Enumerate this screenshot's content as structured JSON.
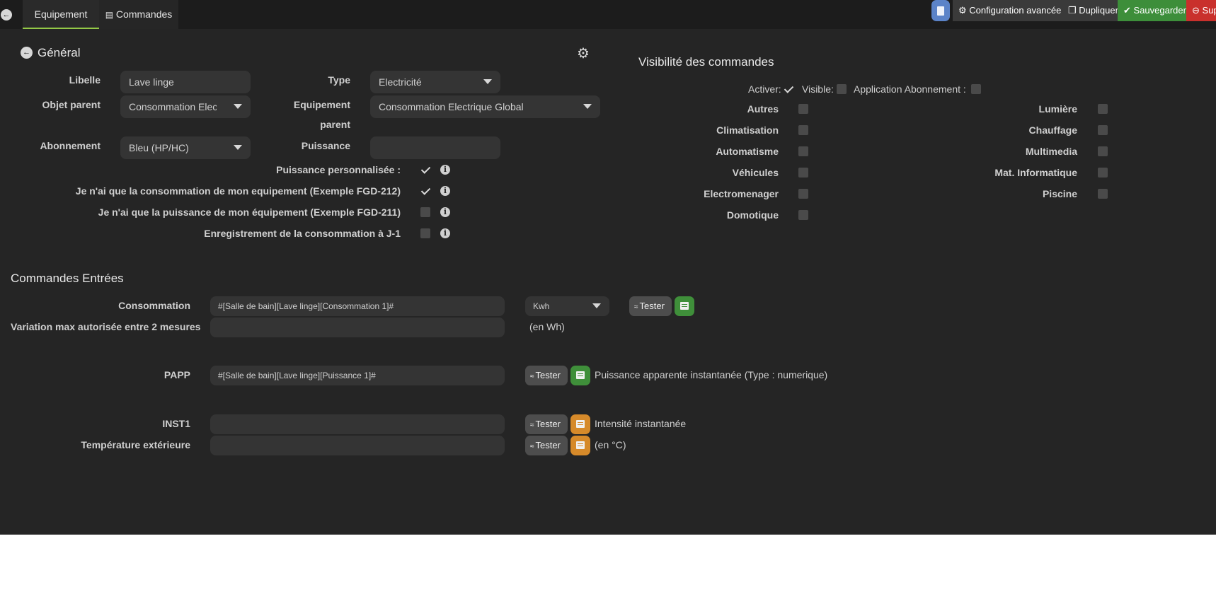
{
  "topbar": {
    "tabs": [
      {
        "label": "Equipement",
        "active": true
      },
      {
        "label": "Commandes",
        "active": false
      }
    ],
    "buttons": {
      "config": "Configuration avancée",
      "duplicate": "Dupliquer",
      "save": "Sauvegarder",
      "delete": "Supprimer"
    },
    "colors": {
      "save": "#3d8e3a",
      "delete": "#c9302c",
      "doc": "#5b83c8"
    }
  },
  "general": {
    "title": "Général",
    "fields": {
      "libelle_label": "Libelle",
      "libelle_value": "Lave linge",
      "type_label": "Type",
      "type_value": "Electricité",
      "objet_parent_label": "Objet parent",
      "objet_parent_value": "Consommation Electrique Global",
      "equipement_parent_label_1": "Equipement",
      "equipement_parent_label_2": "parent",
      "equipement_parent_value": "Consommation Electrique Global",
      "abonnement_label": "Abonnement",
      "abonnement_value": "Bleu (HP/HC)",
      "puissance_label": "Puissance",
      "puissance_value": ""
    },
    "options": [
      {
        "label": "Puissance personnalisée :",
        "checked": true
      },
      {
        "label": "Je n'ai que la consommation de mon equipement (Exemple FGD-212)",
        "checked": true
      },
      {
        "label": "Je n'ai que la puissance de mon équipement (Exemple FGD-211)",
        "checked": false
      },
      {
        "label": "Enregistrement de la consommation à J-1",
        "checked": false
      }
    ]
  },
  "visibility": {
    "title": "Visibilité des commandes",
    "activer": "Activer:",
    "visible": "Visible:",
    "app_abonnement": "Application Abonnement :",
    "left": [
      "Autres",
      "Climatisation",
      "Automatisme",
      "Véhicules",
      "Electromenager",
      "Domotique"
    ],
    "right": [
      "Lumière",
      "Chauffage",
      "Multimedia",
      "Mat. Informatique",
      "Piscine"
    ]
  },
  "commands": {
    "title": "Commandes Entrées",
    "tester_label": "Tester",
    "consommation": {
      "label": "Consommation",
      "value": "#[Salle de bain][Lave linge][Consommation 1]#",
      "unit": "Kwh"
    },
    "variation": {
      "label": "Variation max autorisée entre 2 mesures",
      "value": "",
      "note": "(en Wh)"
    },
    "papp": {
      "label": "PAPP",
      "value": "#[Salle de bain][Lave linge][Puissance 1]#",
      "note": "Puissance apparente instantanée (Type : numerique)"
    },
    "inst1": {
      "label": "INST1",
      "value": "",
      "note": "Intensité instantanée"
    },
    "temp": {
      "label": "Température extérieure",
      "value": "",
      "note": "(en °C)"
    }
  }
}
